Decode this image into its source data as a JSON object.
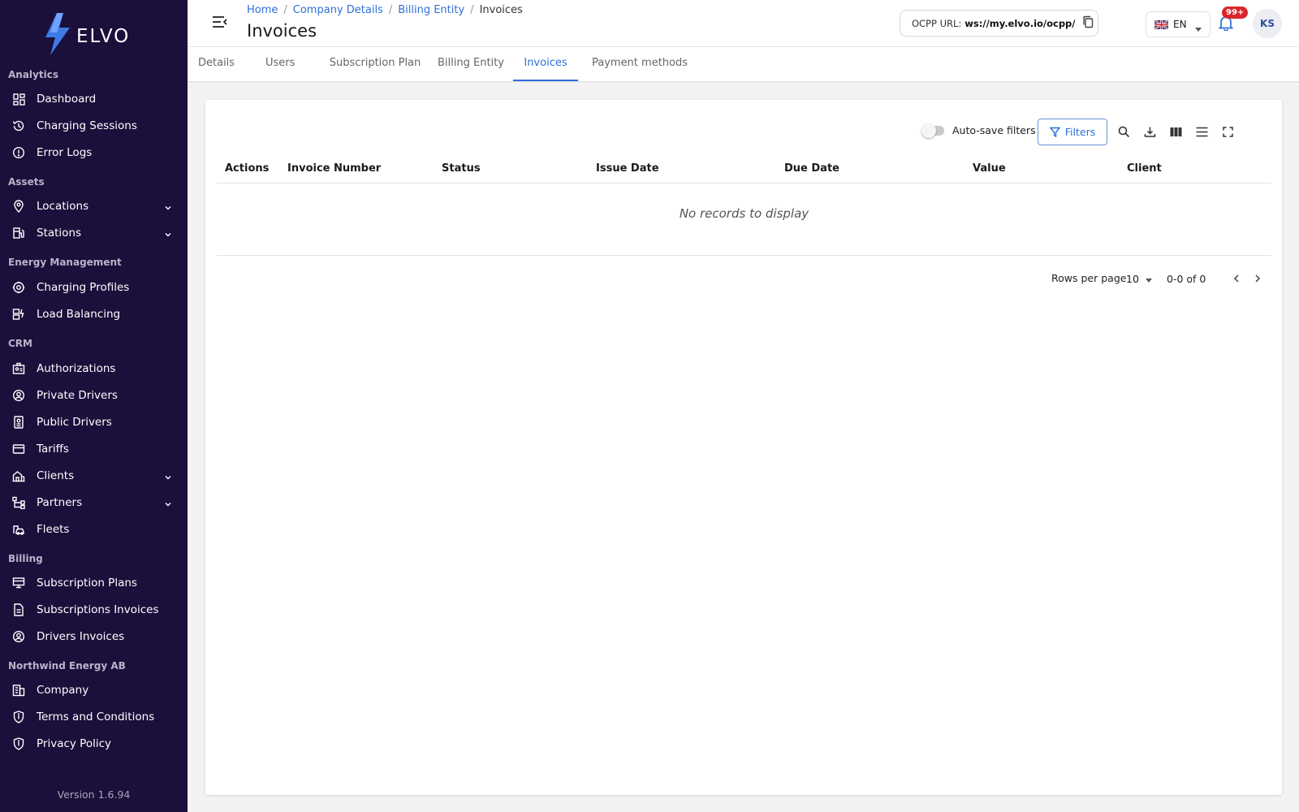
{
  "app": {
    "brand": "ELVO",
    "version": "Version 1.6.94"
  },
  "sidebar": {
    "sections": [
      {
        "title": "Analytics"
      },
      {
        "title": "Assets"
      },
      {
        "title": "Energy Management"
      },
      {
        "title": "CRM"
      },
      {
        "title": "Billing"
      },
      {
        "title": "Northwind Energy AB"
      }
    ],
    "items": [
      {
        "label": "Dashboard",
        "icon": "dashboard-icon"
      },
      {
        "label": "Charging Sessions",
        "icon": "history-icon"
      },
      {
        "label": "Error Logs",
        "icon": "error-icon"
      },
      {
        "label": "Locations",
        "icon": "location-pin-icon",
        "expandable": true
      },
      {
        "label": "Stations",
        "icon": "charging-station-icon",
        "expandable": true
      },
      {
        "label": "Charging Profiles",
        "icon": "profile-gear-icon"
      },
      {
        "label": "Load Balancing",
        "icon": "load-balancing-icon"
      },
      {
        "label": "Authorizations",
        "icon": "id-card-icon"
      },
      {
        "label": "Private Drivers",
        "icon": "user-circle-icon"
      },
      {
        "label": "Public Drivers",
        "icon": "badge-icon"
      },
      {
        "label": "Tariffs",
        "icon": "credit-card-icon"
      },
      {
        "label": "Clients",
        "icon": "building-icon",
        "expandable": true
      },
      {
        "label": "Partners",
        "icon": "hierarchy-icon",
        "expandable": true
      },
      {
        "label": "Fleets",
        "icon": "fleet-icon"
      },
      {
        "label": "Subscription Plans",
        "icon": "plan-icon"
      },
      {
        "label": "Subscriptions Invoices",
        "icon": "document-icon"
      },
      {
        "label": "Drivers Invoices",
        "icon": "user-circle-icon"
      },
      {
        "label": "Company",
        "icon": "company-icon"
      },
      {
        "label": "Terms and Conditions",
        "icon": "shield-icon"
      },
      {
        "label": "Privacy Policy",
        "icon": "shield-icon"
      }
    ]
  },
  "header": {
    "breadcrumb": [
      "Home",
      "Company Details",
      "Billing Entity",
      "Invoices"
    ],
    "title": "Invoices",
    "ocpp_label": "OCPP URL:",
    "ocpp_value": "ws://my.elvo.io/ocpp/",
    "language": "EN",
    "notifications_badge": "99+",
    "avatar_initials": "KS"
  },
  "tabs": [
    "Details",
    "Users",
    "Subscription Plan",
    "Billing Entity",
    "Invoices",
    "Payment methods"
  ],
  "active_tab": "Invoices",
  "toolbar": {
    "autosave_label": "Auto-save filters",
    "autosave_on": false,
    "filters_label": "Filters"
  },
  "table": {
    "columns": [
      "Actions",
      "Invoice Number",
      "Status",
      "Issue Date",
      "Due Date",
      "Value",
      "Client"
    ],
    "rows": [],
    "empty_text": "No records to display"
  },
  "pagination": {
    "rows_per_page_label": "Rows per page",
    "rows_per_page": "10",
    "range": "0-0 of 0"
  },
  "colors": {
    "sidebar_bg": "#1b0f3b",
    "accent": "#2d6fd9",
    "badge": "#d9262c"
  }
}
